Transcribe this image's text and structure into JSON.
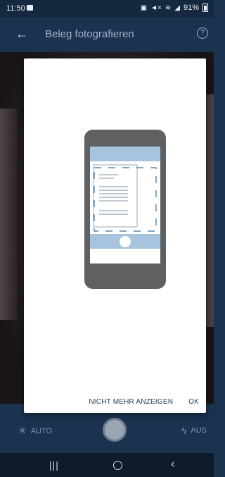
{
  "status_bar": {
    "time": "11:50",
    "battery": "91%",
    "icons": [
      "image-icon",
      "battery-saver-icon",
      "mute-icon",
      "wifi-icon",
      "signal-icon",
      "battery-icon"
    ]
  },
  "app_bar": {
    "title": "Beleg fotografieren",
    "back_icon": "arrow-left-icon",
    "help_icon": "help-icon"
  },
  "dialog": {
    "illustration_icon": "phone-document-scan-icon",
    "buttons": {
      "dont_show_again": "NICHT MEHR ANZEIGEN",
      "ok": "OK"
    }
  },
  "camera_controls": {
    "auto_label": "AUTO",
    "flash_label": "AUS"
  },
  "nav_bar": {
    "icons": [
      "recent-apps-icon",
      "home-icon",
      "back-icon"
    ]
  },
  "colors": {
    "app_bar": "#1c3350",
    "dialog_button_text": "#1e3a5a",
    "phone_body": "#5f6062",
    "phone_accent": "#a7c3de"
  }
}
